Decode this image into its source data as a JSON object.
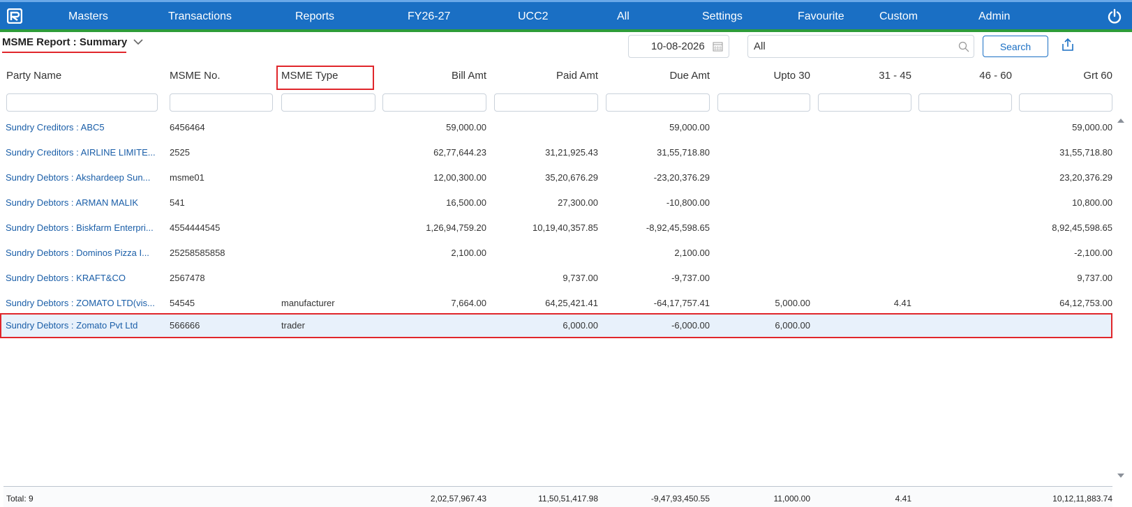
{
  "nav": {
    "items": [
      "Masters",
      "Transactions",
      "Reports",
      "FY26-27",
      "UCC2",
      "All",
      "Settings",
      "Favourite",
      "Custom",
      "Admin"
    ]
  },
  "header": {
    "title": "MSME Report : Summary",
    "date": "10-08-2026",
    "party_filter": "All",
    "search_label": "Search"
  },
  "columns": [
    "Party Name",
    "MSME No.",
    "MSME Type",
    "Bill Amt",
    "Paid Amt",
    "Due Amt",
    "Upto 30",
    "31 - 45",
    "46 - 60",
    "Grt 60"
  ],
  "rows": [
    {
      "party": "Sundry Creditors : ABC5",
      "msme_no": "6456464",
      "msme_type": "",
      "bill": "59,000.00",
      "paid": "",
      "due": "59,000.00",
      "upto30": "",
      "d31_45": "",
      "d46_60": "",
      "grt60": "59,000.00"
    },
    {
      "party": "Sundry Creditors : AIRLINE LIMITE...",
      "msme_no": "2525",
      "msme_type": "",
      "bill": "62,77,644.23",
      "paid": "31,21,925.43",
      "due": "31,55,718.80",
      "upto30": "",
      "d31_45": "",
      "d46_60": "",
      "grt60": "31,55,718.80"
    },
    {
      "party": "Sundry Debtors : Akshardeep Sun...",
      "msme_no": "msme01",
      "msme_type": "",
      "bill": "12,00,300.00",
      "paid": "35,20,676.29",
      "due": "-23,20,376.29",
      "upto30": "",
      "d31_45": "",
      "d46_60": "",
      "grt60": "23,20,376.29"
    },
    {
      "party": "Sundry Debtors : ARMAN MALIK",
      "msme_no": "541",
      "msme_type": "",
      "bill": "16,500.00",
      "paid": "27,300.00",
      "due": "-10,800.00",
      "upto30": "",
      "d31_45": "",
      "d46_60": "",
      "grt60": "10,800.00"
    },
    {
      "party": "Sundry Debtors : Biskfarm Enterpri...",
      "msme_no": "4554444545",
      "msme_type": "",
      "bill": "1,26,94,759.20",
      "paid": "10,19,40,357.85",
      "due": "-8,92,45,598.65",
      "upto30": "",
      "d31_45": "",
      "d46_60": "",
      "grt60": "8,92,45,598.65"
    },
    {
      "party": "Sundry Debtors : Dominos Pizza I...",
      "msme_no": "25258585858",
      "msme_type": "",
      "bill": "2,100.00",
      "paid": "",
      "due": "2,100.00",
      "upto30": "",
      "d31_45": "",
      "d46_60": "",
      "grt60": "-2,100.00"
    },
    {
      "party": "Sundry Debtors : KRAFT&CO",
      "msme_no": "2567478",
      "msme_type": "",
      "bill": "",
      "paid": "9,737.00",
      "due": "-9,737.00",
      "upto30": "",
      "d31_45": "",
      "d46_60": "",
      "grt60": "9,737.00"
    },
    {
      "party": "Sundry Debtors : ZOMATO LTD(vis...",
      "msme_no": "54545",
      "msme_type": "manufacturer",
      "bill": "7,664.00",
      "paid": "64,25,421.41",
      "due": "-64,17,757.41",
      "upto30": "5,000.00",
      "d31_45": "4.41",
      "d46_60": "",
      "grt60": "64,12,753.00"
    },
    {
      "party": "Sundry Debtors : Zomato Pvt Ltd",
      "msme_no": "566666",
      "msme_type": "trader",
      "bill": "",
      "paid": "6,000.00",
      "due": "-6,000.00",
      "upto30": "6,000.00",
      "d31_45": "",
      "d46_60": "",
      "grt60": ""
    }
  ],
  "totals": {
    "label": "Total: 9",
    "bill": "2,02,57,967.43",
    "paid": "11,50,51,417.98",
    "due": "-9,47,93,450.55",
    "upto30": "11,000.00",
    "d31_45": "4.41",
    "d46_60": "",
    "grt60": "10,12,11,883.74"
  },
  "colors": {
    "nav_bg": "#1a6fc4",
    "nav_border": "#2e9c3a",
    "highlight": "#e0262b",
    "link": "#1a5ea8",
    "selected_row_bg": "#e8f1fb"
  },
  "icons": [
    "logo-icon",
    "power-icon",
    "chevron-down-icon",
    "calendar-icon",
    "search-icon",
    "export-icon",
    "scroll-up-icon",
    "scroll-down-icon"
  ]
}
